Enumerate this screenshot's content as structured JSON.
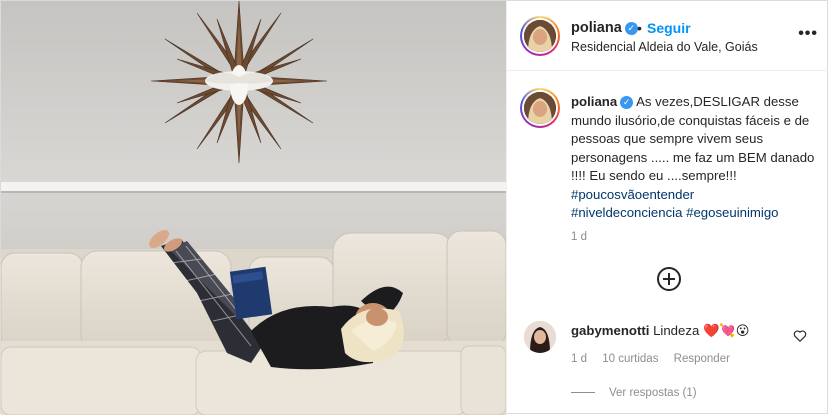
{
  "header": {
    "username": "poliana",
    "separator": "•",
    "follow_label": "Seguir",
    "location": "Residencial Aldeia do Vale, Goiás",
    "more_label": "•••"
  },
  "caption": {
    "username": "poliana",
    "text": "As vezes,DESLIGAR desse mundo ilusório,de conquistas fáceis e de pessoas que sempre vivem seus personagens ..... me faz um BEM danado !!!! Eu sendo eu ....sempre!!!",
    "hashtag_1": "#poucosvãoentender",
    "hashtag_2": "#niveldeconciencia",
    "hashtag_3": "#egoseuinimigo",
    "time": "1 d"
  },
  "comment": {
    "username": "gabymenotti",
    "text": "Lindeza",
    "emoji": "❤️💘😮",
    "time": "1 d",
    "likes": "10 curtidas",
    "reply_label": "Responder",
    "view_replies": "Ver respostas (1)"
  },
  "colors": {
    "accent": "#0095f6",
    "verified": "#3897f0",
    "hashtag": "#00376b",
    "muted": "#8e8e8e"
  }
}
